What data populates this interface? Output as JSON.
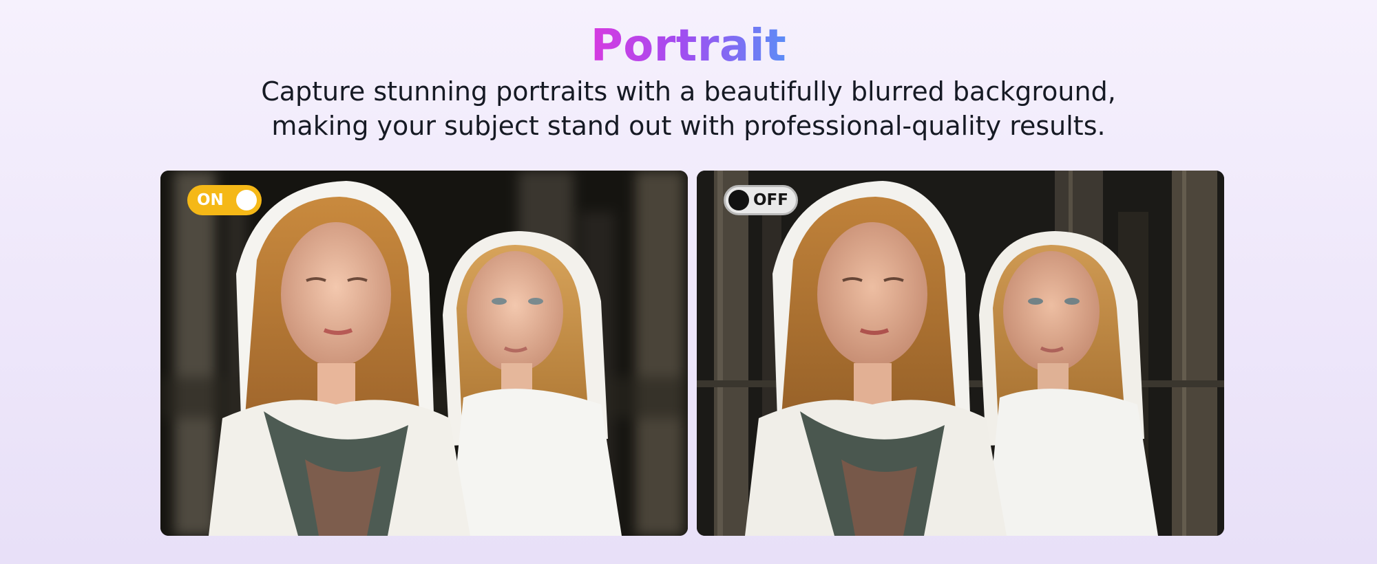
{
  "header": {
    "title": "Portrait",
    "subtitle_line1": "Capture stunning portraits with a beautifully blurred background,",
    "subtitle_line2": "making your subject stand out with professional-quality results."
  },
  "comparison": {
    "left_toggle_label": "ON",
    "right_toggle_label": "OFF"
  },
  "colors": {
    "title_gradient": [
      "#d63be0",
      "#a34cf0",
      "#5c8df6"
    ],
    "toggle_on": "#f5b817",
    "toggle_off": "#e9e9e9"
  }
}
